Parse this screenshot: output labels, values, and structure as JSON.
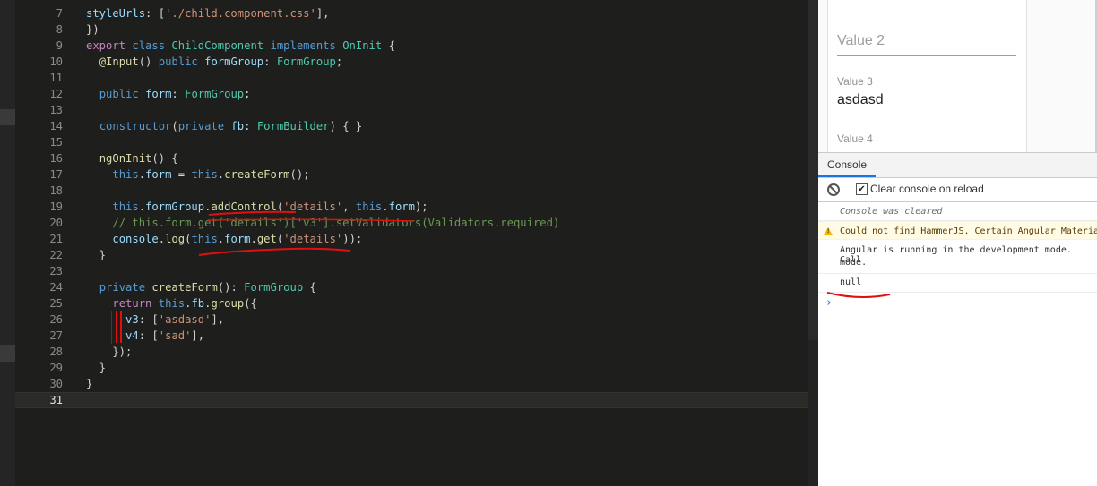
{
  "editor": {
    "lines": [
      {
        "n": "7",
        "tokens": [
          [
            "pr",
            "styleUrls"
          ],
          [
            "pu",
            ": ["
          ],
          [
            "st",
            "'./child.component.css'"
          ],
          [
            "pu",
            "],"
          ]
        ]
      },
      {
        "n": "8",
        "tokens": [
          [
            "pu",
            "})"
          ]
        ]
      },
      {
        "n": "9",
        "tokens": [
          [
            "kw2",
            "export"
          ],
          [
            "pu",
            " "
          ],
          [
            "kw",
            "class"
          ],
          [
            "pu",
            " "
          ],
          [
            "ty",
            "ChildComponent"
          ],
          [
            "pu",
            " "
          ],
          [
            "kw",
            "implements"
          ],
          [
            "pu",
            " "
          ],
          [
            "ty",
            "OnInit"
          ],
          [
            "pu",
            " {"
          ]
        ]
      },
      {
        "n": "10",
        "tokens": [
          [
            "pu",
            "  "
          ],
          [
            "fn",
            "@Input"
          ],
          [
            "pu",
            "() "
          ],
          [
            "kw",
            "public"
          ],
          [
            "pu",
            " "
          ],
          [
            "pr",
            "formGroup"
          ],
          [
            "pu",
            ": "
          ],
          [
            "ty",
            "FormGroup"
          ],
          [
            "pu",
            ";"
          ]
        ]
      },
      {
        "n": "11",
        "tokens": []
      },
      {
        "n": "12",
        "tokens": [
          [
            "pu",
            "  "
          ],
          [
            "kw",
            "public"
          ],
          [
            "pu",
            " "
          ],
          [
            "pr",
            "form"
          ],
          [
            "pu",
            ": "
          ],
          [
            "ty",
            "FormGroup"
          ],
          [
            "pu",
            ";"
          ]
        ]
      },
      {
        "n": "13",
        "tokens": []
      },
      {
        "n": "14",
        "tokens": [
          [
            "pu",
            "  "
          ],
          [
            "kw",
            "constructor"
          ],
          [
            "pu",
            "("
          ],
          [
            "kw",
            "private"
          ],
          [
            "pu",
            " "
          ],
          [
            "pr",
            "fb"
          ],
          [
            "pu",
            ": "
          ],
          [
            "ty",
            "FormBuilder"
          ],
          [
            "pu",
            ") { }"
          ]
        ]
      },
      {
        "n": "15",
        "tokens": []
      },
      {
        "n": "16",
        "tokens": [
          [
            "pu",
            "  "
          ],
          [
            "fn",
            "ngOnInit"
          ],
          [
            "pu",
            "() {"
          ]
        ]
      },
      {
        "n": "17",
        "tokens": [
          [
            "pu",
            "    "
          ],
          [
            "kw",
            "this"
          ],
          [
            "pu",
            "."
          ],
          [
            "pr",
            "form"
          ],
          [
            "pu",
            " = "
          ],
          [
            "kw",
            "this"
          ],
          [
            "pu",
            "."
          ],
          [
            "fn",
            "createForm"
          ],
          [
            "pu",
            "();"
          ]
        ]
      },
      {
        "n": "18",
        "tokens": []
      },
      {
        "n": "19",
        "tokens": [
          [
            "pu",
            "    "
          ],
          [
            "kw",
            "this"
          ],
          [
            "pu",
            "."
          ],
          [
            "pr",
            "formGroup"
          ],
          [
            "pu",
            "."
          ],
          [
            "fn",
            "addControl"
          ],
          [
            "pu",
            "("
          ],
          [
            "st",
            "'details'"
          ],
          [
            "pu",
            ", "
          ],
          [
            "kw",
            "this"
          ],
          [
            "pu",
            "."
          ],
          [
            "pr",
            "form"
          ],
          [
            "pu",
            ");"
          ]
        ]
      },
      {
        "n": "20",
        "tokens": [
          [
            "pu",
            "    "
          ],
          [
            "cm",
            "// this.form.get('details')['v3'].setValidators(Validators.required)"
          ]
        ]
      },
      {
        "n": "21",
        "tokens": [
          [
            "pu",
            "    "
          ],
          [
            "pr",
            "console"
          ],
          [
            "pu",
            "."
          ],
          [
            "fn",
            "log"
          ],
          [
            "pu",
            "("
          ],
          [
            "kw",
            "this"
          ],
          [
            "pu",
            "."
          ],
          [
            "pr",
            "form"
          ],
          [
            "pu",
            "."
          ],
          [
            "fn",
            "get"
          ],
          [
            "pu",
            "("
          ],
          [
            "st",
            "'details'"
          ],
          [
            "pu",
            "));"
          ]
        ]
      },
      {
        "n": "22",
        "tokens": [
          [
            "pu",
            "  }"
          ]
        ]
      },
      {
        "n": "23",
        "tokens": []
      },
      {
        "n": "24",
        "tokens": [
          [
            "pu",
            "  "
          ],
          [
            "kw",
            "private"
          ],
          [
            "pu",
            " "
          ],
          [
            "fn",
            "createForm"
          ],
          [
            "pu",
            "(): "
          ],
          [
            "ty",
            "FormGroup"
          ],
          [
            "pu",
            " {"
          ]
        ]
      },
      {
        "n": "25",
        "tokens": [
          [
            "pu",
            "    "
          ],
          [
            "kw2",
            "return"
          ],
          [
            "pu",
            " "
          ],
          [
            "kw",
            "this"
          ],
          [
            "pu",
            "."
          ],
          [
            "pr",
            "fb"
          ],
          [
            "pu",
            "."
          ],
          [
            "fn",
            "group"
          ],
          [
            "pu",
            "({"
          ]
        ]
      },
      {
        "n": "26",
        "tokens": [
          [
            "pu",
            "      "
          ],
          [
            "pr",
            "v3"
          ],
          [
            "pu",
            ": ["
          ],
          [
            "st",
            "'asdasd'"
          ],
          [
            "pu",
            "],"
          ]
        ]
      },
      {
        "n": "27",
        "tokens": [
          [
            "pu",
            "      "
          ],
          [
            "pr",
            "v4"
          ],
          [
            "pu",
            ": ["
          ],
          [
            "st",
            "'sad'"
          ],
          [
            "pu",
            "],"
          ]
        ]
      },
      {
        "n": "28",
        "tokens": [
          [
            "pu",
            "    });"
          ]
        ]
      },
      {
        "n": "29",
        "tokens": [
          [
            "pu",
            "  }"
          ]
        ]
      },
      {
        "n": "30",
        "tokens": [
          [
            "pu",
            "}"
          ]
        ]
      },
      {
        "n": "31",
        "tokens": [],
        "current": true
      }
    ]
  },
  "form": {
    "value2_label": "Value 2",
    "value3_label": "Value 3",
    "value3_value": "asdasd",
    "value4_label": "Value 4"
  },
  "devtools": {
    "tab_console": "Console",
    "clear_on_reload_label": "Clear console on reload",
    "clear_on_reload_checked": "✔",
    "messages": {
      "cleared": "Console was cleared",
      "warning": "Could not find HammerJS. Certain Angular Material",
      "angular_line1": "Angular is running in the development mode. Call",
      "angular_line2": "mode.",
      "null_output": "null"
    },
    "prompt": "›"
  },
  "colors": {
    "annotation_red": "#e01010",
    "editor_bg": "#1e1f1c",
    "accent_blue": "#1a73e8"
  }
}
